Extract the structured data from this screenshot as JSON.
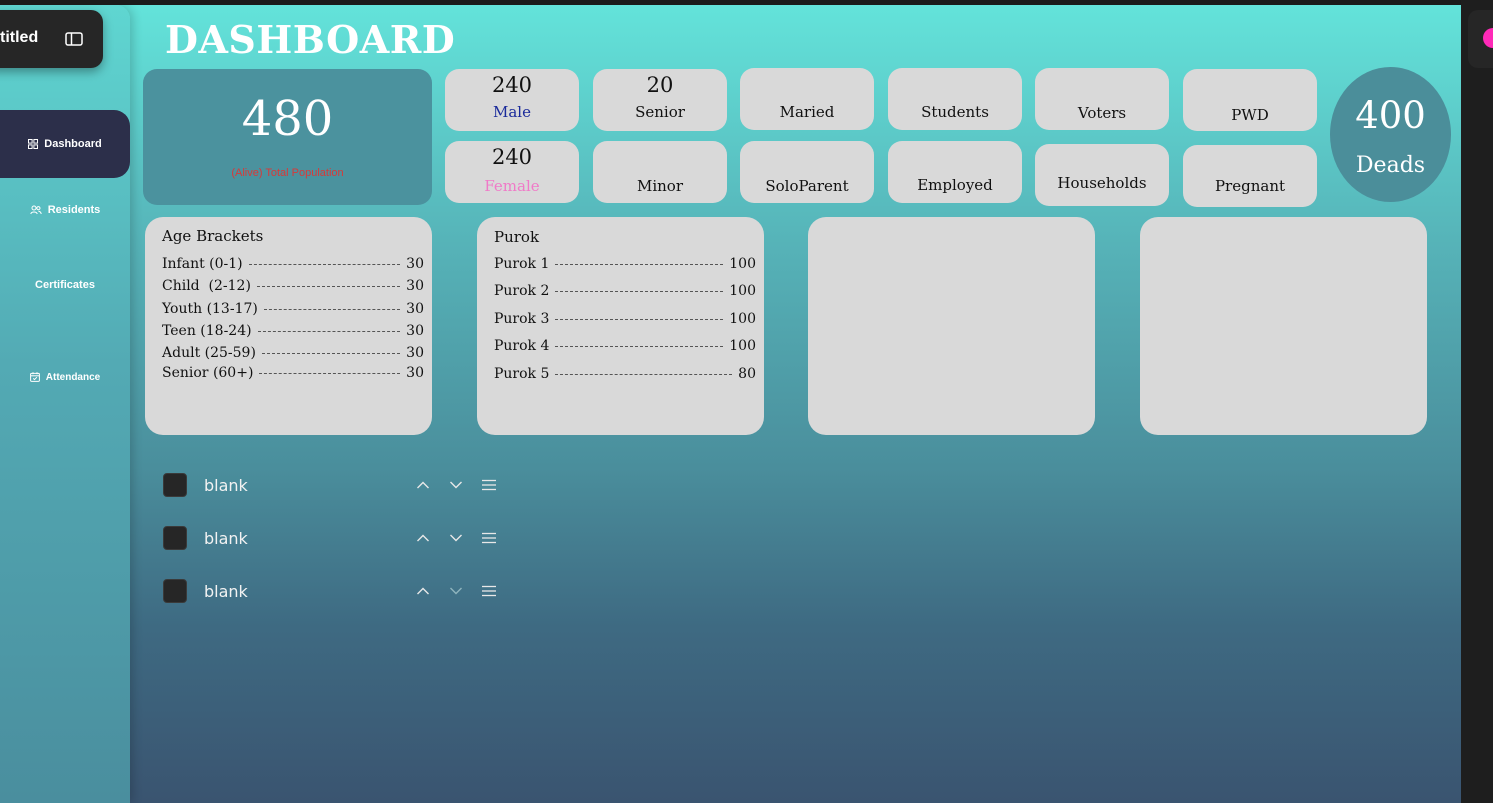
{
  "app": {
    "window_title": "titled",
    "page_title": "DASHBOARD"
  },
  "sidebar": {
    "items": [
      {
        "label": "Dashboard",
        "icon": "grid-icon",
        "active": true
      },
      {
        "label": "Residents",
        "icon": "users-icon"
      },
      {
        "label": "Certificates"
      },
      {
        "label": "Attendance",
        "icon": "calendar-icon"
      }
    ]
  },
  "total": {
    "value": "480",
    "label": "(Alive) Total Population"
  },
  "stats": {
    "male": {
      "value": "240",
      "label": "Male"
    },
    "senior": {
      "value": "20",
      "label": "Senior"
    },
    "maried": {
      "label": "Maried"
    },
    "students": {
      "label": "Students"
    },
    "voters": {
      "label": "Voters"
    },
    "pwd": {
      "label": "PWD"
    },
    "female": {
      "value": "240",
      "label": "Female"
    },
    "minor": {
      "label": "Minor"
    },
    "soloparent": {
      "label": "SoloParent"
    },
    "employed": {
      "label": "Employed"
    },
    "households": {
      "label": "Households"
    },
    "pregnant": {
      "label": "Pregnant"
    }
  },
  "deads": {
    "value": "400",
    "label": "Deads"
  },
  "age_brackets": {
    "title": "Age Brackets",
    "rows": [
      {
        "label": "Infant (0-1)",
        "value": "30"
      },
      {
        "label": "Child  (2-12)",
        "value": "30"
      },
      {
        "label": "Youth (13-17)",
        "value": "30"
      },
      {
        "label": "Teen (18-24)",
        "value": "30"
      },
      {
        "label": "Adult (25-59)",
        "value": "30"
      },
      {
        "label": "Senior (60+)",
        "value": "30"
      }
    ]
  },
  "purok": {
    "title": "Purok",
    "rows": [
      {
        "label": "Purok 1",
        "value": "100"
      },
      {
        "label": "Purok 2",
        "value": "100"
      },
      {
        "label": "Purok 3",
        "value": "100"
      },
      {
        "label": "Purok 4",
        "value": "100"
      },
      {
        "label": "Purok 5",
        "value": "80"
      }
    ]
  },
  "layers": [
    {
      "label": "blank"
    },
    {
      "label": "blank"
    },
    {
      "label": "blank"
    }
  ],
  "colors": {
    "male_text": "#1a2a9a",
    "female_text": "#f07ac8",
    "total_label": "#d63a3a",
    "active_nav": "#2c2f4a",
    "accent_dot": "#ff2ab8"
  }
}
